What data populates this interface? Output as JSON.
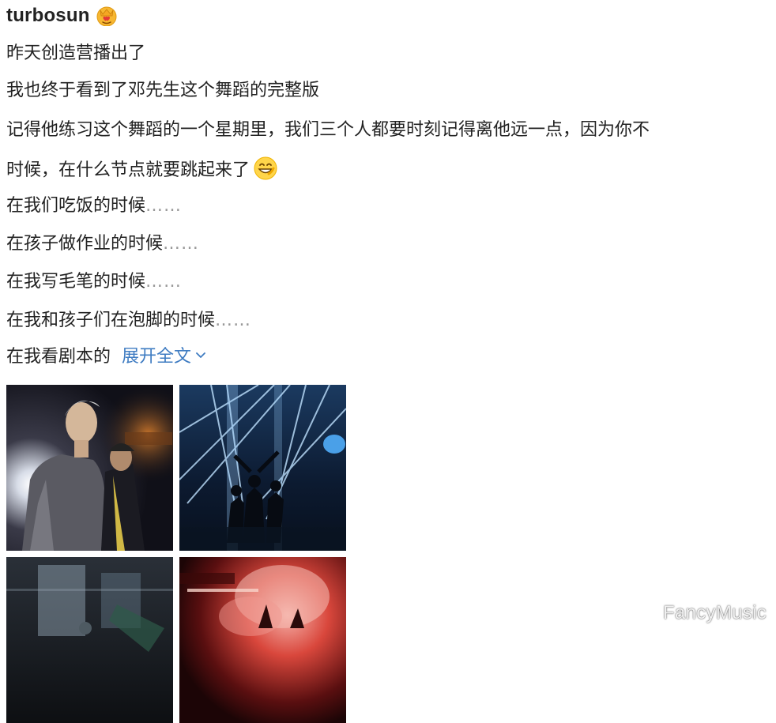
{
  "post": {
    "username": "turbosun",
    "badge_icon": "crown-heart-badge-icon",
    "lines": [
      "昨天创造营播出了",
      "我也终于看到了邓先生这个舞蹈的完整版",
      "记得他练习这个舞蹈的一个星期里，我们三个人都要时刻记得离他远一点，因为你不",
      "时候，在什么节点就要跳起来了",
      "在我们吃饭的时候",
      "在孩子做作业的时候",
      "在我写毛笔的时候",
      "在我和孩子们在泡脚的时候",
      "在我看剧本的"
    ],
    "ellipsis": "……",
    "emoji_icon": "grinning-face-emoji-icon",
    "expand_label": "展开全文",
    "expand_icon": "chevron-down-icon",
    "images": [
      {
        "name": "photo-dancer-spotlight"
      },
      {
        "name": "photo-stage-laser-lights"
      },
      {
        "name": "photo-stage-dark"
      },
      {
        "name": "photo-stage-red-smoke"
      }
    ]
  },
  "watermark": "FancyMusic",
  "colors": {
    "text": "#222222",
    "link": "#3f7cc2",
    "ellipsis": "#999999",
    "background": "#ffffff"
  }
}
